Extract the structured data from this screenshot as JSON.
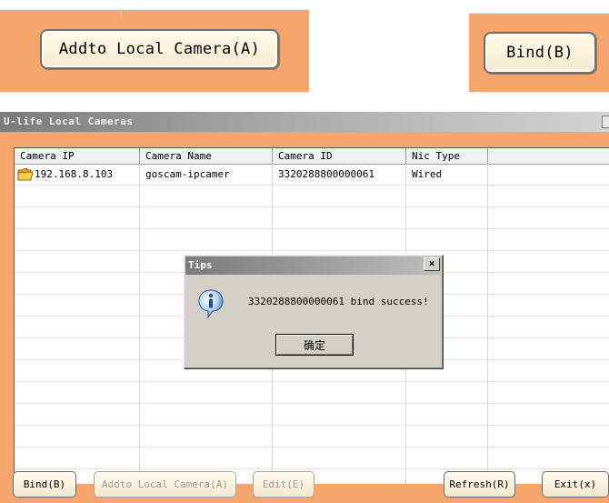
{
  "zoom_crops": {
    "add_button": {
      "label": "Addto Local Camera",
      "hotkey": "(A)"
    },
    "bind_button": {
      "label": "Bind",
      "hotkey": "(B)"
    }
  },
  "window": {
    "title": "U-life Local Cameras",
    "columns": [
      "Camera IP",
      "Camera Name",
      "Camera ID",
      "Nic Type"
    ],
    "rows": [
      {
        "ip": "192.168.8.103",
        "name": "goscam-ipcamer",
        "id": "3320288800000061",
        "nic": "Wired"
      }
    ],
    "buttons": {
      "bind": {
        "label": "Bind",
        "hotkey": "(B)"
      },
      "add": {
        "label": "Addto Local Camera",
        "hotkey": "(A)"
      },
      "edit": {
        "label": "Edit",
        "hotkey": "(E)"
      },
      "refresh": {
        "label": "Refresh",
        "hotkey": "(R)"
      },
      "exit": {
        "label": "Exit",
        "hotkey": "(x)"
      }
    }
  },
  "dialog": {
    "title": "Tips",
    "close_glyph": "×",
    "message": "3320288800000061 bind success!",
    "ok_label": "确定",
    "icon": "info-icon"
  },
  "colors": {
    "accent": "#f6a56c",
    "dialog_bg": "#d4d0c8"
  }
}
